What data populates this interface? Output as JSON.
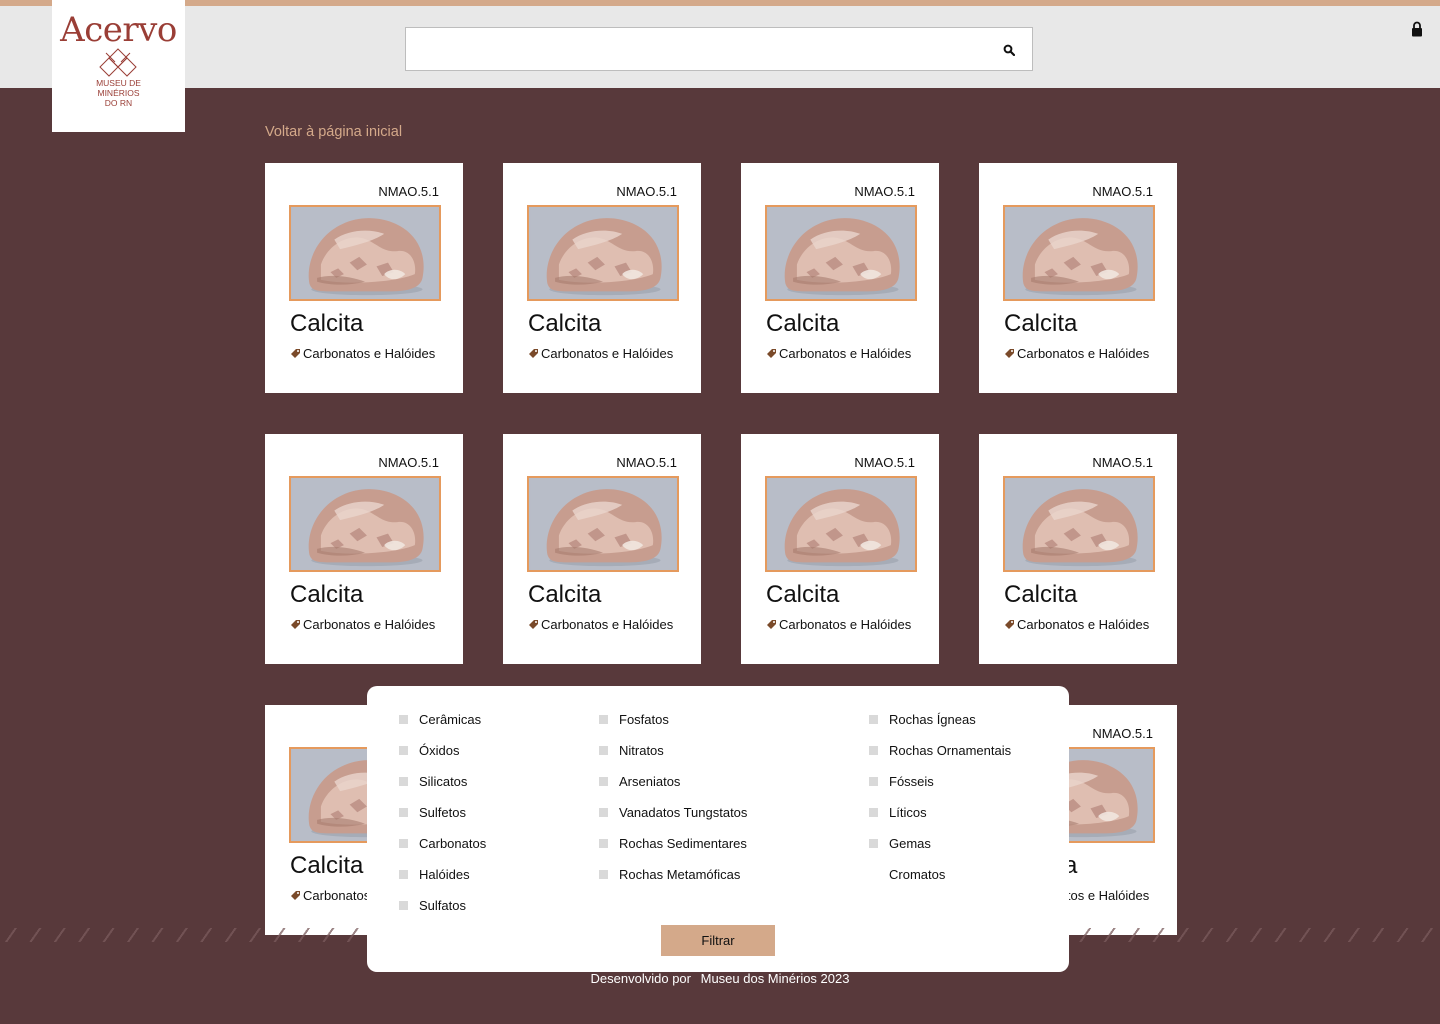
{
  "brand": {
    "logo_word": "Acervo",
    "logo_sub_line1": "Museu de",
    "logo_sub_line2": "Minérios",
    "logo_sub_line3": "do RN",
    "color": "#9a3e36"
  },
  "header": {
    "search_value": "",
    "search_icon": "search-icon",
    "lock_icon": "lock-icon"
  },
  "nav": {
    "back_label": "Voltar à página inicial"
  },
  "cards": [
    {
      "code": "NMAO.5.1",
      "name": "Calcita",
      "category": "Carbonatos e Halóides"
    },
    {
      "code": "NMAO.5.1",
      "name": "Calcita",
      "category": "Carbonatos e Halóides"
    },
    {
      "code": "NMAO.5.1",
      "name": "Calcita",
      "category": "Carbonatos e Halóides"
    },
    {
      "code": "NMAO.5.1",
      "name": "Calcita",
      "category": "Carbonatos e Halóides"
    },
    {
      "code": "NMAO.5.1",
      "name": "Calcita",
      "category": "Carbonatos e Halóides"
    },
    {
      "code": "NMAO.5.1",
      "name": "Calcita",
      "category": "Carbonatos e Halóides"
    },
    {
      "code": "NMAO.5.1",
      "name": "Calcita",
      "category": "Carbonatos e Halóides"
    },
    {
      "code": "NMAO.5.1",
      "name": "Calcita",
      "category": "Carbonatos e Halóides"
    },
    {
      "code": "NMAO.5.1",
      "name": "Calcita",
      "category": "Carbonatos e Halóides"
    },
    {
      "code": "NMAO.5.1",
      "name": "Calcita",
      "category": "Carbonatos e Halóides"
    }
  ],
  "filter": {
    "col1": [
      "Cerâmicas",
      "Óxidos",
      "Silicatos",
      "Sulfetos",
      "Carbonatos",
      "Halóides",
      "Sulfatos"
    ],
    "col2": [
      "Fosfatos",
      "Nitratos",
      "Arseniatos",
      "Vanadatos Tungstatos",
      "Rochas Sedimentares",
      "Rochas Metamóficas"
    ],
    "col3": [
      "Rochas Ígneas",
      "Rochas Ornamentais",
      "Fósseis",
      "Líticos",
      "Gemas",
      "Cromatos"
    ],
    "button_label": "Filtrar"
  },
  "footer": {
    "prefix": "Desenvolvido por",
    "owner": "Museu dos Minérios 2023"
  },
  "colors": {
    "background": "#58393b",
    "accent": "#d4a98a",
    "image_border": "#e59a5d"
  }
}
